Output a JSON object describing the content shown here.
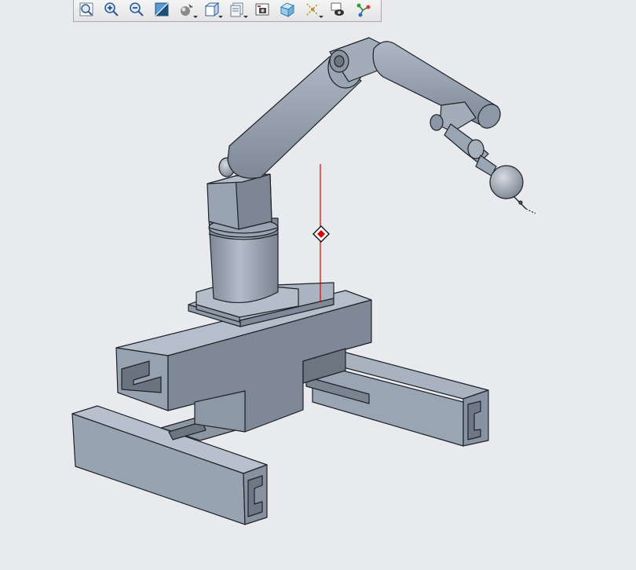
{
  "window": {
    "title": ""
  },
  "toolbar": {
    "buttons": [
      {
        "icon": "zoom-refit-icon",
        "has_menu": false
      },
      {
        "icon": "zoom-in-icon",
        "has_menu": false
      },
      {
        "icon": "zoom-out-icon",
        "has_menu": false
      },
      {
        "icon": "repaint-icon",
        "has_menu": false
      },
      {
        "icon": "reorient-icon",
        "has_menu": true
      },
      {
        "icon": "display-style-icon",
        "has_menu": true
      },
      {
        "icon": "saved-views-icon",
        "has_menu": true
      },
      {
        "icon": "view-manager-icon",
        "has_menu": false
      },
      {
        "icon": "perspective-icon",
        "has_menu": false
      },
      {
        "icon": "datum-display-icon",
        "has_menu": true
      },
      {
        "icon": "annotation-display-icon",
        "has_menu": false
      },
      {
        "icon": "mechanism-connections-icon",
        "has_menu": false
      }
    ]
  },
  "colors": {
    "background": "#e9eaed",
    "model_light": "#a4afbd",
    "model_mid": "#8c97a6",
    "model_dark": "#6f7884",
    "edge": "#1f2228",
    "datum_red": "#e00000"
  },
  "model": {
    "name": "robot-arm-assembly"
  }
}
